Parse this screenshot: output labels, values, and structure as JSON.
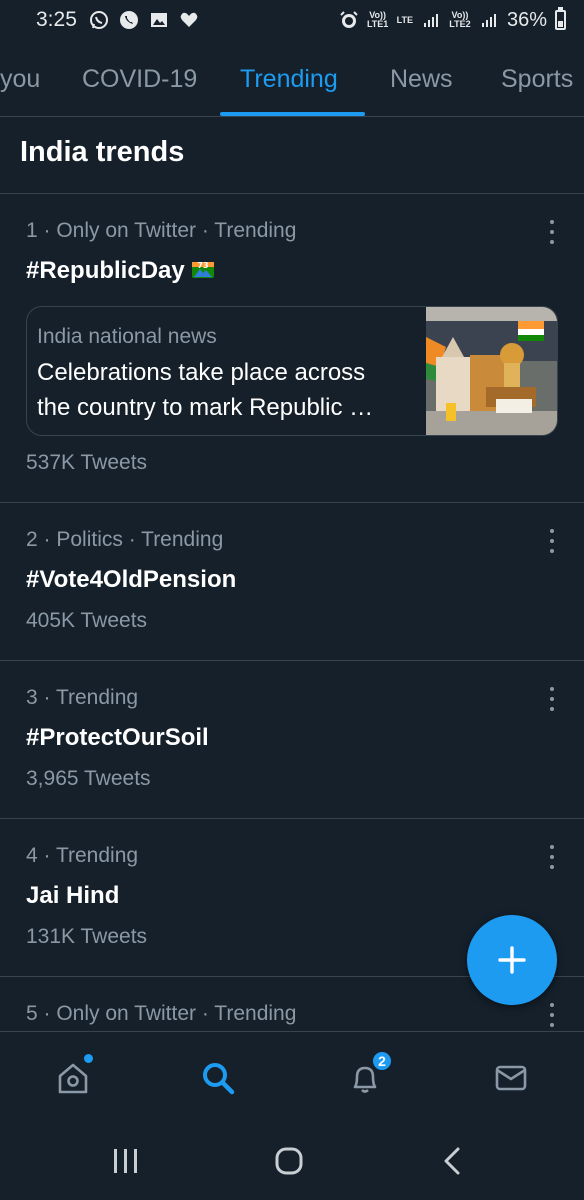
{
  "status_bar": {
    "time": "3:25",
    "battery_percent": "36%",
    "battery_level": 0.36,
    "sim1_label": "Vo)) LTE1",
    "lte_label": "LTE",
    "sim2_label": "Vo)) LTE2",
    "icons": [
      "whatsapp-icon",
      "phone-icon",
      "gallery-icon",
      "heart-icon",
      "alarm-icon",
      "signal-icon",
      "battery-icon"
    ]
  },
  "tabs": [
    {
      "label": "you"
    },
    {
      "label": "COVID-19"
    },
    {
      "label": "Trending",
      "active": true
    },
    {
      "label": "News"
    },
    {
      "label": "Sports"
    }
  ],
  "section_title": "India trends",
  "trends": [
    {
      "meta": "1 · Only on Twitter · Trending",
      "name": "#RepublicDay",
      "has_emoji": true,
      "emoji_text": "73",
      "news": {
        "source": "India national news",
        "headline_line1": "Celebrations take place across",
        "headline_line2": "the country to mark Republic …"
      },
      "count": "537K Tweets"
    },
    {
      "meta": "2 · Politics · Trending",
      "name": "#Vote4OldPension",
      "count": "405K Tweets"
    },
    {
      "meta": "3 · Trending",
      "name": "#ProtectOurSoil",
      "count": "3,965 Tweets"
    },
    {
      "meta": "4 · Trending",
      "name": "Jai Hind",
      "count": "131K Tweets"
    },
    {
      "meta": "5 · Only on Twitter · Trending"
    }
  ],
  "bottom_nav": {
    "items": [
      "home-icon",
      "search-icon",
      "notifications-icon",
      "messages-icon"
    ],
    "active": "search-icon",
    "notification_count": "2"
  },
  "colors": {
    "background": "#15202b",
    "accent": "#1d9bf0",
    "secondary_text": "#8b98a5",
    "divider": "#38444d"
  }
}
